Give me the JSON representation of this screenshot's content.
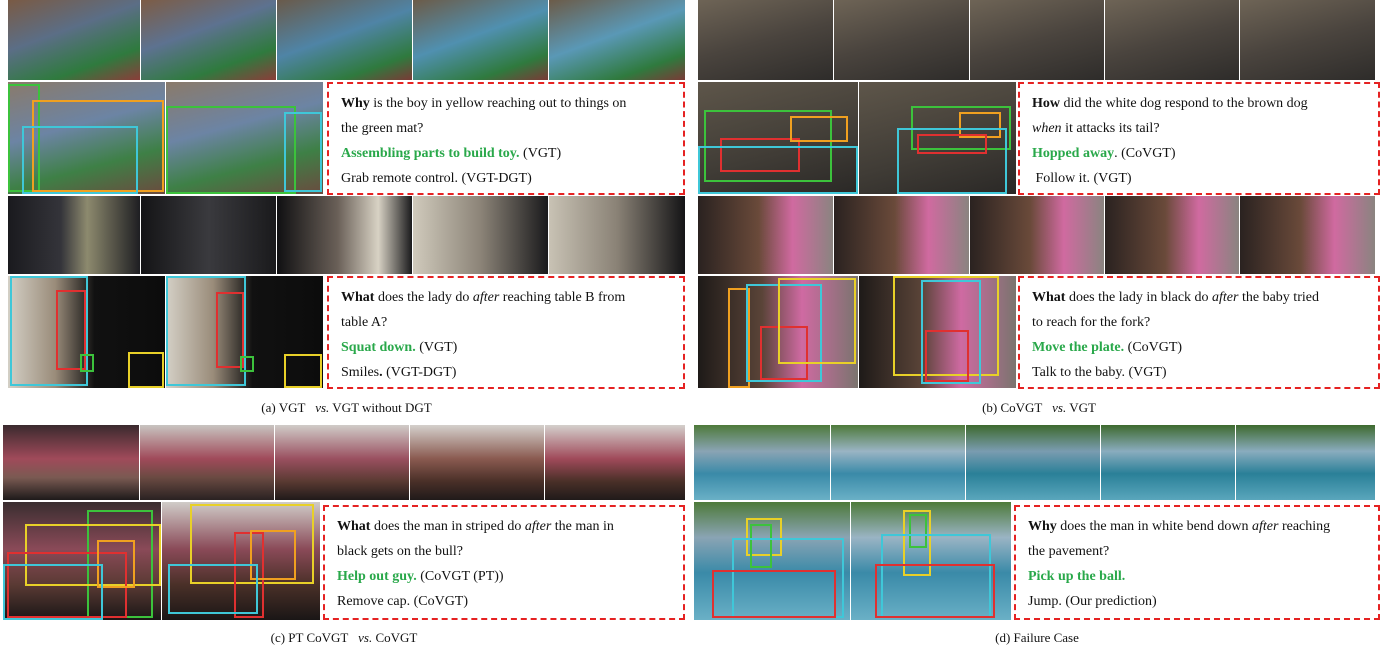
{
  "panels": {
    "a": {
      "caption": {
        "pre": "(a) VGT",
        "vs": "vs.",
        "post": "VGT without DGT"
      },
      "q1": {
        "wh": "Why",
        "rest1": " is the boy in yellow reaching out to things on",
        "line2": "the green mat?",
        "correct": "Assembling parts to build toy.",
        "correct_tag": " (VGT)",
        "wrong": "Grab remote control. (VGT-DGT)"
      },
      "q2": {
        "wh": "What",
        "mid": " does the lady do ",
        "em": "after",
        "rest1": " reaching table B from",
        "line2": "table A?",
        "correct": "Squat down.",
        "correct_tag": " (VGT)",
        "wrong_pre": "Smiles",
        "wrong_dot": ".",
        "wrong_tag": " (VGT-DGT)"
      }
    },
    "b": {
      "caption": {
        "pre": "(b) CoVGT",
        "vs": "vs.",
        "post": "VGT"
      },
      "q1": {
        "wh": "How",
        "rest1": " did the white dog respond to the brown dog",
        "em": "when",
        "line2": " it attacks its tail?",
        "correct": "Hopped away",
        "correct_tag": ". (CoVGT)",
        "wrong": "Follow it. (VGT)"
      },
      "q2": {
        "wh": "What",
        "mid": " does the lady in black do ",
        "em": "after",
        "rest1": " the baby tried",
        "line2": "to reach for the fork?",
        "correct": "Move the plate.",
        "correct_tag": " (CoVGT)",
        "wrong": "Talk to the baby. (VGT)"
      }
    },
    "c": {
      "caption": {
        "pre": "(c) PT CoVGT",
        "vs": "vs.",
        "post": "CoVGT"
      },
      "q1": {
        "wh": "What",
        "mid": " does the man in striped do ",
        "em": "after",
        "rest1": " the man in",
        "line2": "black gets on the bull?",
        "correct": "Help out guy.",
        "correct_tag": " (CoVGT (PT))",
        "wrong": "Remove cap. (CoVGT)"
      }
    },
    "d": {
      "caption": {
        "text": "(d) Failure Case"
      },
      "q1": {
        "wh": "Why",
        "mid": " does the man in white bend down ",
        "em": "after",
        "rest1": " reaching",
        "line2": "the pavement?",
        "correct": "Pick up the ball.",
        "wrong": "Jump. (Our prediction)"
      }
    }
  },
  "colors": {
    "answer_green": "#29a84a",
    "dash_red": "#e52222",
    "box_cyan": "#3fc7d8",
    "box_green": "#3cc23c",
    "box_orange": "#f0a020",
    "box_red": "#e03030",
    "box_yellow": "#e8d028"
  }
}
